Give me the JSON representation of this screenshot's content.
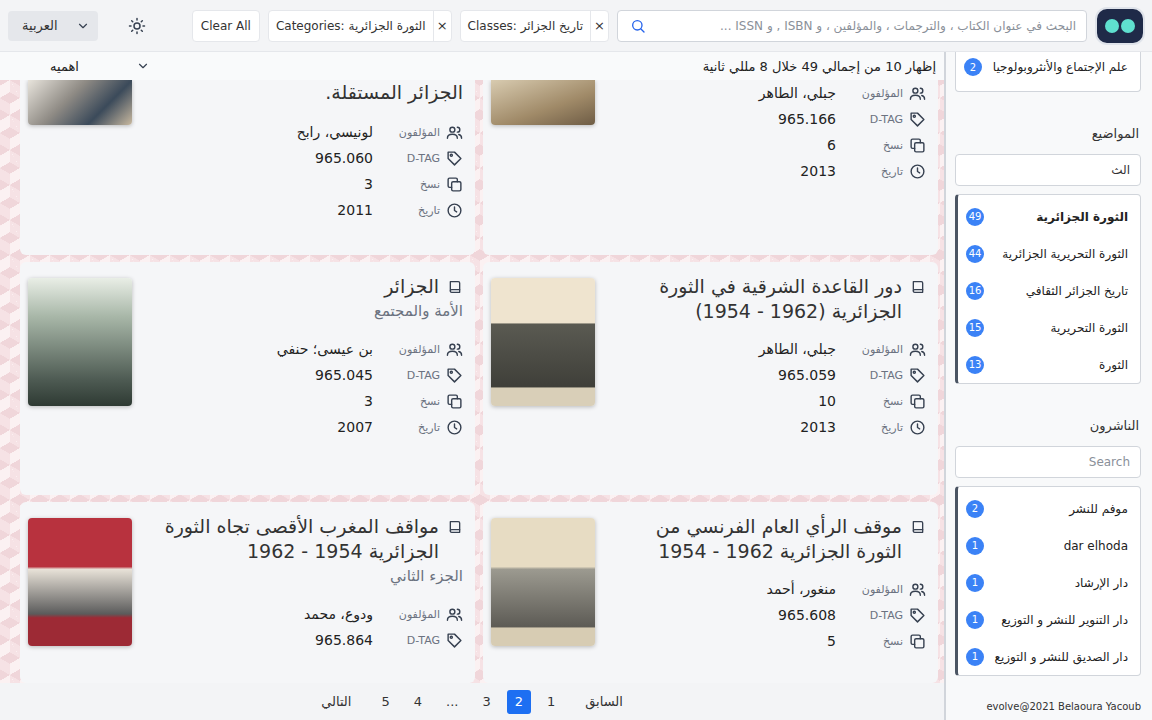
{
  "header": {
    "language": "العربية",
    "clear_all": "Clear All",
    "filters": [
      {
        "label": "Categories: الثورة الجزائرية",
        "remove": "×"
      },
      {
        "label": "Classes: تاريخ الجزائر",
        "remove": "×"
      }
    ],
    "search": {
      "placeholder": "البحث في عنوان الكتاب ، والترجمات ، والمؤلفين ، و ISBN , و ISSN ..."
    }
  },
  "results": {
    "sort": "اهميه",
    "info": "إظهار 10 من إجمالي 49 خلال 8 مللي ثانية"
  },
  "cards": [
    {
      "kind": "cut",
      "fields": [
        {
          "kind": "authors",
          "label": "المؤلفون",
          "value": "جبلي، الطاهر"
        },
        {
          "kind": "tag",
          "label": "D-TAG",
          "value": "965.166"
        },
        {
          "kind": "copies",
          "label": "نسخ",
          "value": "6"
        },
        {
          "kind": "date",
          "label": "تاريخ",
          "value": "2013"
        }
      ]
    },
    {
      "kind": "cut",
      "title": "الجزائر المستقلة.",
      "fields": [
        {
          "kind": "authors",
          "label": "المؤلفون",
          "value": "لونيسي، رابح"
        },
        {
          "kind": "tag",
          "label": "D-TAG",
          "value": "965.060"
        },
        {
          "kind": "copies",
          "label": "نسخ",
          "value": "3"
        },
        {
          "kind": "date",
          "label": "تاريخ",
          "value": "2011"
        }
      ]
    },
    {
      "kind": "full",
      "title": "دور القاعدة الشرقية في الثورة الجزائرية (1962 - 1954)",
      "fields": [
        {
          "kind": "authors",
          "label": "المؤلفون",
          "value": "جبلي، الطاهر"
        },
        {
          "kind": "tag",
          "label": "D-TAG",
          "value": "965.059"
        },
        {
          "kind": "copies",
          "label": "نسخ",
          "value": "10"
        },
        {
          "kind": "date",
          "label": "تاريخ",
          "value": "2013"
        }
      ]
    },
    {
      "kind": "full",
      "title": "الجزائر",
      "subtitle": "الأمة والمجتمع",
      "fields": [
        {
          "kind": "authors",
          "label": "المؤلفون",
          "value": "بن عيسى؛ حنفي"
        },
        {
          "kind": "tag",
          "label": "D-TAG",
          "value": "965.045"
        },
        {
          "kind": "copies",
          "label": "نسخ",
          "value": "3"
        },
        {
          "kind": "date",
          "label": "تاريخ",
          "value": "2007"
        }
      ]
    },
    {
      "kind": "full",
      "title": "موقف الرأي العام الفرنسي من الثورة الجزائرية 1962 - 1954",
      "fields": [
        {
          "kind": "authors",
          "label": "المؤلفون",
          "value": "منغور، أحمد"
        },
        {
          "kind": "tag",
          "label": "D-TAG",
          "value": "965.608"
        },
        {
          "kind": "copies",
          "label": "نسخ",
          "value": "5"
        }
      ]
    },
    {
      "kind": "full",
      "title": "مواقف المغرب الأقصى تجاه الثورة الجزائرية 1954 - 1962",
      "subtitle": "الجزء الثاني",
      "fields": [
        {
          "kind": "authors",
          "label": "المؤلفون",
          "value": "ودوع، محمد"
        },
        {
          "kind": "tag",
          "label": "D-TAG",
          "value": "965.864"
        }
      ]
    }
  ],
  "pagination": [
    {
      "label": "السابق",
      "selected": false
    },
    {
      "label": "1",
      "selected": false
    },
    {
      "label": "2",
      "selected": true
    },
    {
      "label": "3",
      "selected": false
    },
    {
      "label": "...",
      "selected": false
    },
    {
      "label": "4",
      "selected": false
    },
    {
      "label": "5",
      "selected": false
    },
    {
      "label": "التالي",
      "selected": false
    }
  ],
  "sidebar": {
    "top_items": [
      {
        "label": "علم الإجتماع والأنثروبولوجيا",
        "count": "2",
        "selected": false
      }
    ],
    "topics": {
      "heading": "المواضيع",
      "search_value": "الث",
      "items": [
        {
          "label": "الثورة الجزائرية",
          "count": "49",
          "selected": true
        },
        {
          "label": "الثورة التحريرية الجزائرية",
          "count": "44",
          "selected": false
        },
        {
          "label": "تاريخ الجزائر الثقافي",
          "count": "16",
          "selected": false
        },
        {
          "label": "الثورة التحريرية",
          "count": "15",
          "selected": false
        },
        {
          "label": "الثورة",
          "count": "13",
          "selected": false
        }
      ]
    },
    "publishers": {
      "heading": "الناشرون",
      "search_placeholder": "Search",
      "items": [
        {
          "label": "موفم للنشر",
          "count": "2",
          "selected": false
        },
        {
          "label": "dar elhoda",
          "count": "1",
          "selected": false
        },
        {
          "label": "دار الإرشاد",
          "count": "1",
          "selected": false
        },
        {
          "label": "دار التنوير للنشر و التوزيع",
          "count": "1",
          "selected": false
        },
        {
          "label": "دار الصديق للنشر و التوزيع",
          "count": "1",
          "selected": false
        }
      ]
    }
  },
  "footer": "evolve@2021 Belaoura Yacoub"
}
